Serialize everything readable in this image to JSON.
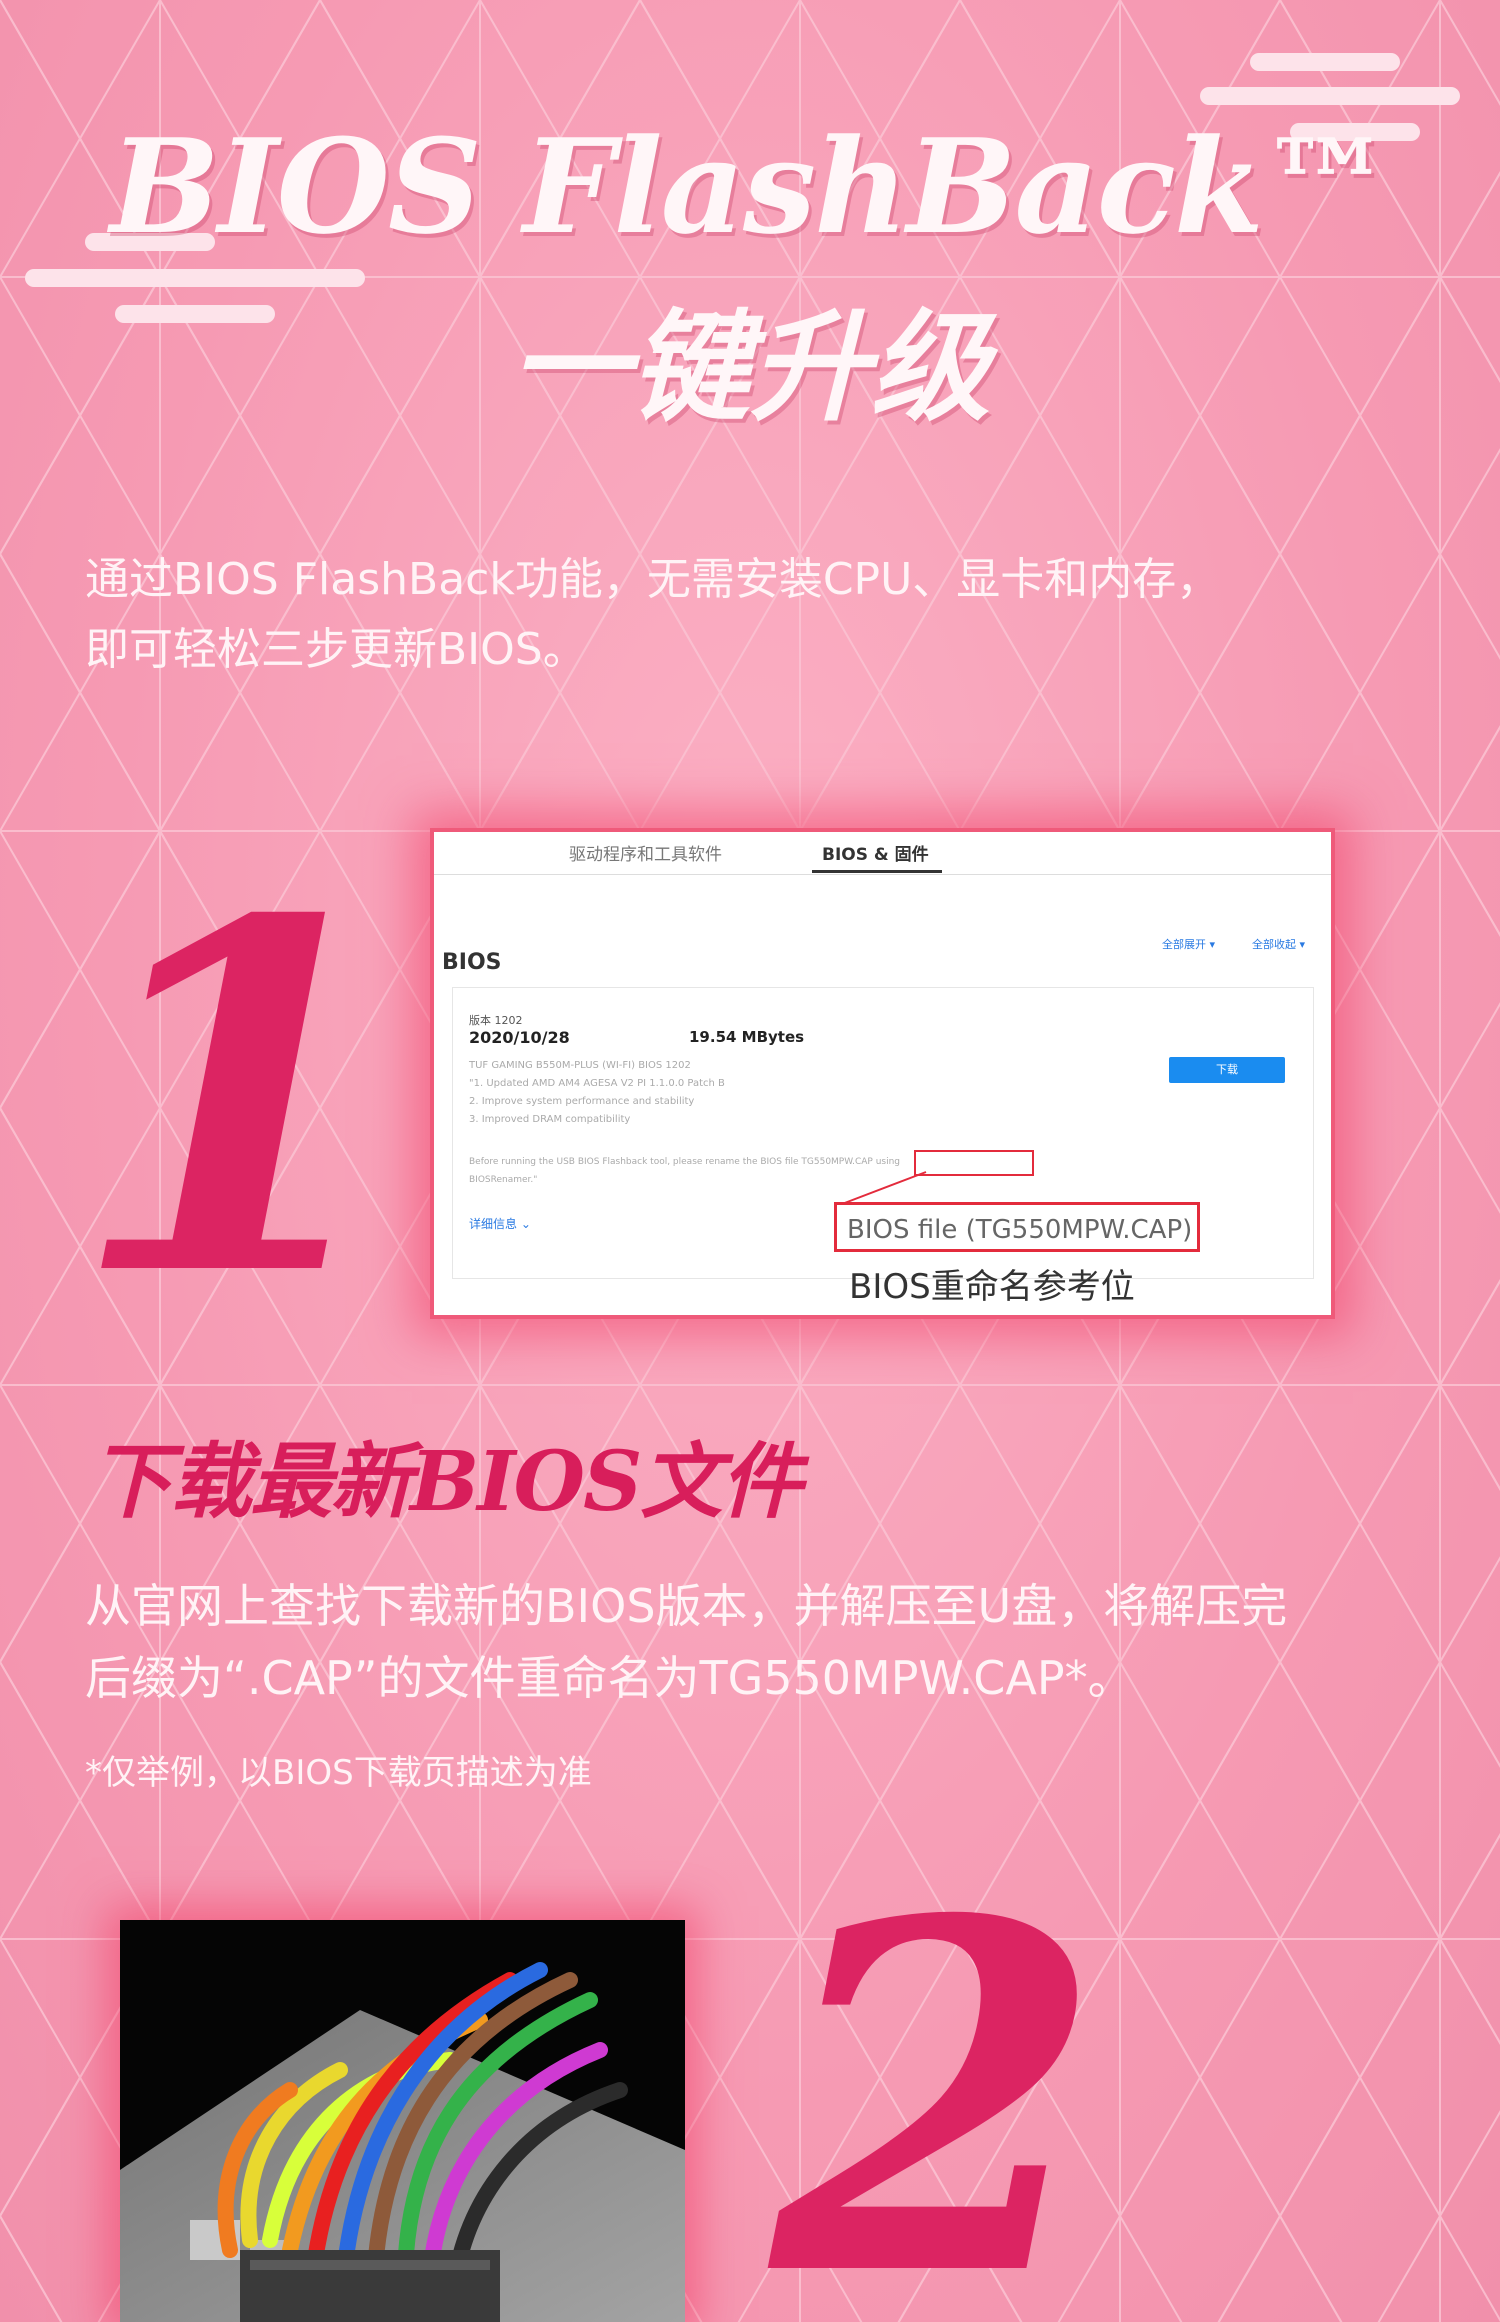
{
  "header": {
    "title_line1": "BIOS FlashBack™",
    "title_line2": "一键升级"
  },
  "intro": {
    "line1": "通过BIOS   FlashBack功能，无需安装CPU、显卡和内存，",
    "line2": "即可轻松三步更新BIOS。"
  },
  "step1": {
    "number": "1",
    "screenshot": {
      "tabs": [
        "驱动程序和工具软件",
        "BIOS & 固件"
      ],
      "section_title": "BIOS",
      "expand_all": "全部展开 ▾",
      "collapse_all": "全部收起 ▾",
      "version_label": "版本 1202",
      "date": "2020/10/28",
      "size": "19.54 MBytes",
      "desc_lines": [
        "TUF GAMING B550M-PLUS (WI-FI) BIOS 1202",
        "\"1. Updated AMD AM4 AGESA V2 PI 1.1.0.0 Patch B",
        "2. Improve system performance and stability",
        "3. Improved DRAM compatibility"
      ],
      "rename_note_line1": "Before running the USB BIOS Flashback tool, please rename the BIOS file TG550MPW.CAP using",
      "rename_note_line2": "BIOSRenamer.\"",
      "download_button": "下载",
      "details_link": "详细信息 ⌄",
      "callout_text": "BIOS file (TG550MPW.CAP)",
      "reference_label": "BIOS重命名参考位"
    },
    "heading": "下载最新BIOS文件",
    "desc_line1": "从官网上查找下载新的BIOS版本，并解压至U盘，将解压完",
    "desc_line2": "后缀为“.CAP”的文件重命名为TG550MPW.CAP*。",
    "note": "*仅举例，以BIOS下载页描述为准"
  },
  "step2": {
    "number": "2"
  },
  "colors": {
    "background": "#f7a2bb",
    "accent": "#dc2462",
    "text_light": "#fff3f6"
  }
}
